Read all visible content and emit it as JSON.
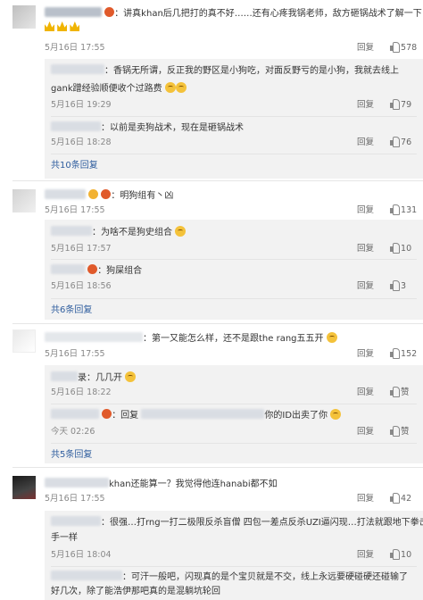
{
  "comments": [
    {
      "text": "：讲真khan后几把打的真不好……还有心疼我锅老师，敌方砸锅战术了解一下",
      "time": "5月16日 17:55",
      "reply_label": "回复",
      "like_count": "578",
      "replies": [
        {
          "text": "：香锅无所谓，反正我的野区是小狗吃，对面反野亏的是小狗，我就去线上",
          "text2": "gank蹭经验顺便收个过路费",
          "time": "5月16日 19:29",
          "reply_label": "回复",
          "like_count": "79"
        },
        {
          "text": "：以前是卖狗战术，现在是砸锅战术",
          "time": "5月16日 18:28",
          "reply_label": "回复",
          "like_count": "76"
        }
      ],
      "more": "共10条回复"
    },
    {
      "text": "：明狗组有丶凶",
      "time": "5月16日 17:55",
      "reply_label": "回复",
      "like_count": "131",
      "replies": [
        {
          "text": "：为啥不是狗史组合",
          "time": "5月16日 17:57",
          "reply_label": "回复",
          "like_count": "10"
        },
        {
          "text": "：狗屎组合",
          "time": "5月16日 18:56",
          "reply_label": "回复",
          "like_count": "3"
        }
      ],
      "more": "共6条回复"
    },
    {
      "text": "：第一又能怎么样，还不是跟the rang五五开",
      "time": "5月16日 17:55",
      "reply_label": "回复",
      "like_count": "152",
      "replies": [
        {
          "text": "录：几几开",
          "time": "5月16日 18:22",
          "reply_label": "回复",
          "like_count": "赞"
        },
        {
          "text": "：回复",
          "text2": "你的ID出卖了你",
          "time": "今天 02:26",
          "reply_label": "回复",
          "like_count": "赞"
        }
      ],
      "more": "共5条回复"
    },
    {
      "text": "khan还能算一？我觉得他连hanabi都不如",
      "time": "5月16日 17:55",
      "reply_label": "回复",
      "like_count": "42",
      "replies": [
        {
          "text": "：很强…打rng一打二极限反杀盲僧 四包一差点反杀UZI逼闪现…打法就跟地下拳击",
          "text2": "手一样",
          "time": "5月16日 18:04",
          "reply_label": "回复",
          "like_count": "10"
        },
        {
          "text": "：可汗一般吧，闪现真的是个宝贝就是不交，线上永远要硬碰硬还碰输了",
          "text2": "好几次，除了能浩伊那吧真的是混躺坑轮回"
        }
      ]
    }
  ]
}
